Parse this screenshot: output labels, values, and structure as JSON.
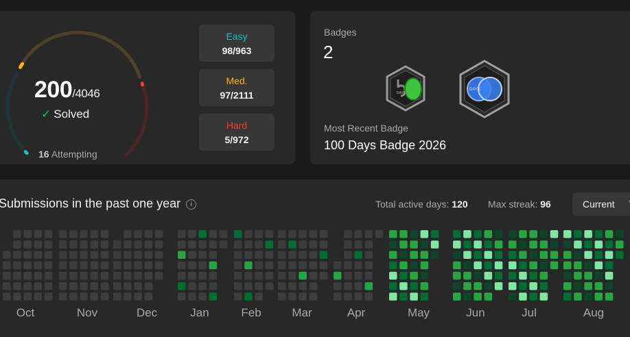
{
  "progress": {
    "solved": "200",
    "total": "/4046",
    "solved_label": "Solved",
    "attempting_count": "16",
    "attempting_label": "Attempting"
  },
  "difficulty": {
    "easy": {
      "label": "Easy",
      "value": "98/963"
    },
    "medium": {
      "label": "Med.",
      "value": "97/2111"
    },
    "hard": {
      "label": "Hard",
      "value": "5/972"
    }
  },
  "badges": {
    "label": "Badges",
    "count": "2",
    "badge1_text": "DAYS",
    "badge2_text": "DAYS",
    "recent_label": "Most Recent Badge",
    "recent_name": "100 Days Badge 2026"
  },
  "submissions": {
    "title": "Submissions in the past one year",
    "active_days_label": "Total active days:",
    "active_days": "120",
    "max_streak_label": "Max streak:",
    "max_streak": "96",
    "dropdown_value": "Current"
  },
  "months": [
    "Oct",
    "Nov",
    "Dec",
    "Jan",
    "Feb",
    "Mar",
    "Apr",
    "May",
    "Jun",
    "Jul",
    "Aug"
  ],
  "colors": {
    "easy": "#1cbaba",
    "medium": "#ffb700",
    "hard": "#f63737",
    "empty_cell": "#3d3d3d",
    "level1": "#0e4429",
    "level2": "#006d32",
    "level3": "#26a641",
    "level4": "#7ee8a0"
  }
}
